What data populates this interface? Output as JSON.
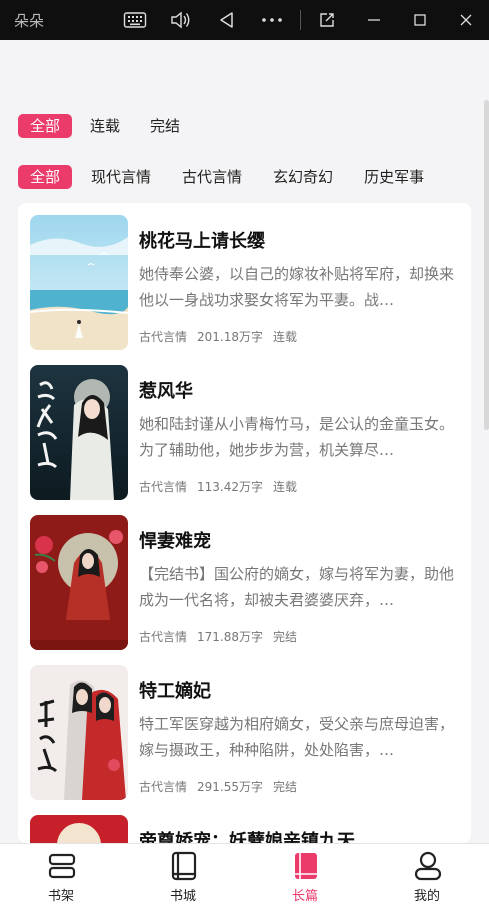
{
  "window": {
    "title": "朵朵",
    "buttons": [
      "keyboard-icon",
      "volume-icon",
      "back-triangle-icon",
      "more-icon",
      "resize-icon",
      "minimize-icon",
      "maximize-icon",
      "close-icon"
    ]
  },
  "status_filter": {
    "options": [
      "全部",
      "连载",
      "完结"
    ],
    "selected": "全部"
  },
  "genre_filter": {
    "options": [
      "全部",
      "现代言情",
      "古代言情",
      "玄幻奇幻",
      "历史军事"
    ],
    "selected": "全部"
  },
  "books": [
    {
      "title": "桃花马上请长缨",
      "description": "她侍奉公婆，以自己的嫁妆补贴将军府，却换来他以一身战功求娶女将军为平妻。战…",
      "genre": "古代言情",
      "words": "201.18万字",
      "status": "连载",
      "cover": "beach-scene"
    },
    {
      "title": "惹风华",
      "description": "她和陆封谨从小青梅竹马，是公认的金童玉女。为了辅助他，她步步为营，机关算尽…",
      "genre": "古代言情",
      "words": "113.42万字",
      "status": "连载",
      "cover": "ancient-lady"
    },
    {
      "title": "悍妻难宠",
      "description": "【完结书】国公府的嫡女，嫁与将军为妻，助他成为一代名将，却被夫君婆婆厌弃，…",
      "genre": "古代言情",
      "words": "171.88万字",
      "status": "完结",
      "cover": "red-portrait"
    },
    {
      "title": "特工嫡妃",
      "description": "特工军医穿越为相府嫡女，受父亲与庶母迫害，嫁与摄政王，种种陷阱，处处陷害，…",
      "genre": "古代言情",
      "words": "291.55万字",
      "status": "完结",
      "cover": "couple-art"
    },
    {
      "title": "帝尊娇宠：妖孽娘亲镇九天",
      "cover": "red-cover"
    }
  ],
  "bottom_nav": {
    "items": [
      {
        "label": "书架",
        "icon": "bookshelf-icon"
      },
      {
        "label": "书城",
        "icon": "bookstore-icon"
      },
      {
        "label": "长篇",
        "icon": "book-icon"
      },
      {
        "label": "我的",
        "icon": "profile-icon"
      }
    ],
    "active": "长篇"
  },
  "colors": {
    "accent": "#ea3b6b",
    "titlebar": "#0f0f0f",
    "background": "#f4f4f6"
  }
}
